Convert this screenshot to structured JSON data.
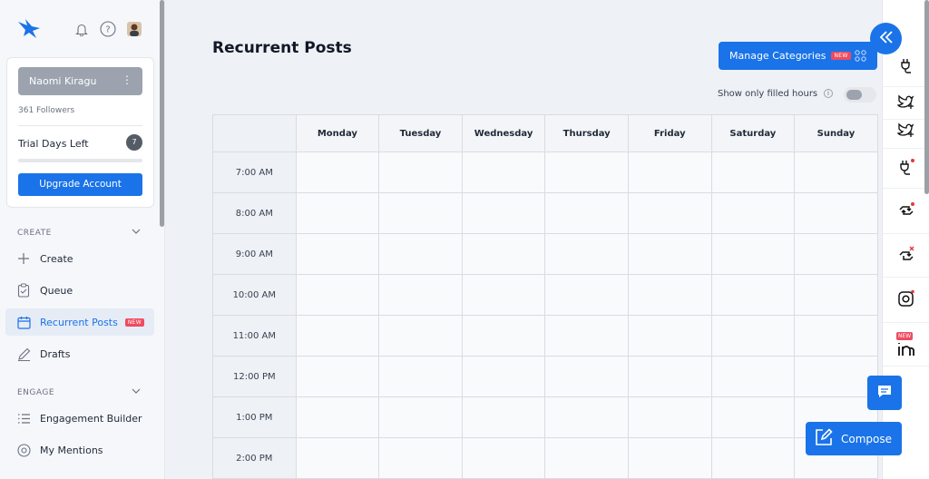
{
  "user": {
    "name": "Naomi Kiragu",
    "followers": "361 Followers"
  },
  "trial": {
    "label": "Trial Days Left",
    "days": "7"
  },
  "upgrade_label": "Upgrade Account",
  "sections": {
    "create": "CREATE",
    "engage": "ENGAGE"
  },
  "nav": {
    "create": "Create",
    "queue": "Queue",
    "recurrent": "Recurrent Posts",
    "recurrent_badge": "NEW",
    "drafts": "Drafts",
    "engagement_builder": "Engagement Builder",
    "mentions": "My Mentions"
  },
  "page": {
    "title": "Recurrent Posts",
    "manage_categories": "Manage Categories",
    "manage_badge": "NEW",
    "filled_hours_label": "Show only filled hours"
  },
  "calendar": {
    "days": [
      "Monday",
      "Tuesday",
      "Wednesday",
      "Thursday",
      "Friday",
      "Saturday",
      "Sunday"
    ],
    "times": [
      "7:00 AM",
      "8:00 AM",
      "9:00 AM",
      "10:00 AM",
      "11:00 AM",
      "12:00 PM",
      "1:00 PM",
      "2:00 PM"
    ]
  },
  "rightbar": {
    "linkedin_badge": "NEW"
  },
  "compose_label": "Compose",
  "colors": {
    "accent": "#1a73e8",
    "new_badge": "#ef4b5f",
    "notify_dot": "#e53935"
  }
}
